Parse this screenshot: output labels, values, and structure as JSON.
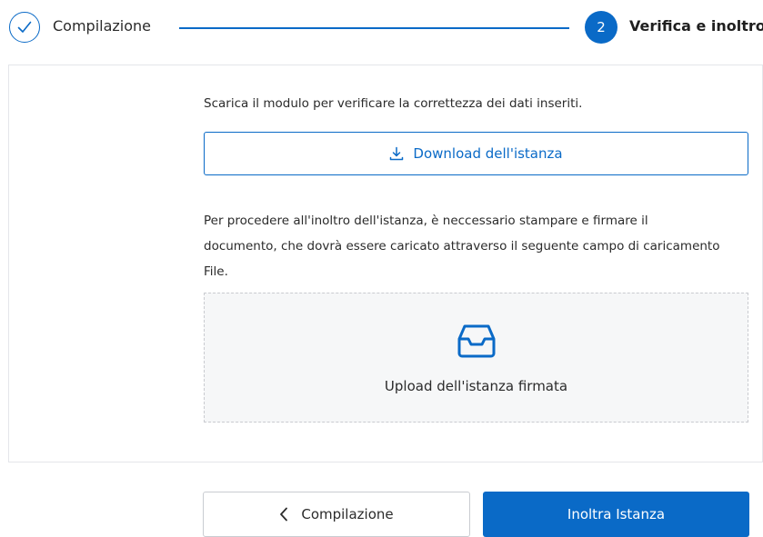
{
  "stepper": {
    "step1": {
      "label": "Compilazione",
      "state": "completed",
      "icon": "check-icon"
    },
    "step2": {
      "number": "2",
      "label": "Verifica e inoltro",
      "state": "active"
    }
  },
  "content": {
    "intro_text": "Scarica il modulo per verificare la correttezza dei dati inseriti.",
    "download_button": {
      "label": "Download dell'istanza",
      "icon": "download-icon"
    },
    "description": "Per procedere all'inoltro dell'istanza, è neccessario stampare e firmare il documento, che dovrà essere caricato attraverso il seguente campo di caricamento File.",
    "upload": {
      "label": "Upload dell'istanza firmata",
      "icon": "inbox-tray-icon"
    }
  },
  "actions": {
    "back_button": {
      "label": "Compilazione",
      "icon": "chevron-left-icon"
    },
    "submit_button": {
      "label": "Inoltra Istanza"
    }
  },
  "colors": {
    "primary": "#0a6ac7",
    "border": "#e4e6ea",
    "upload_bg": "#f6f7f8"
  }
}
